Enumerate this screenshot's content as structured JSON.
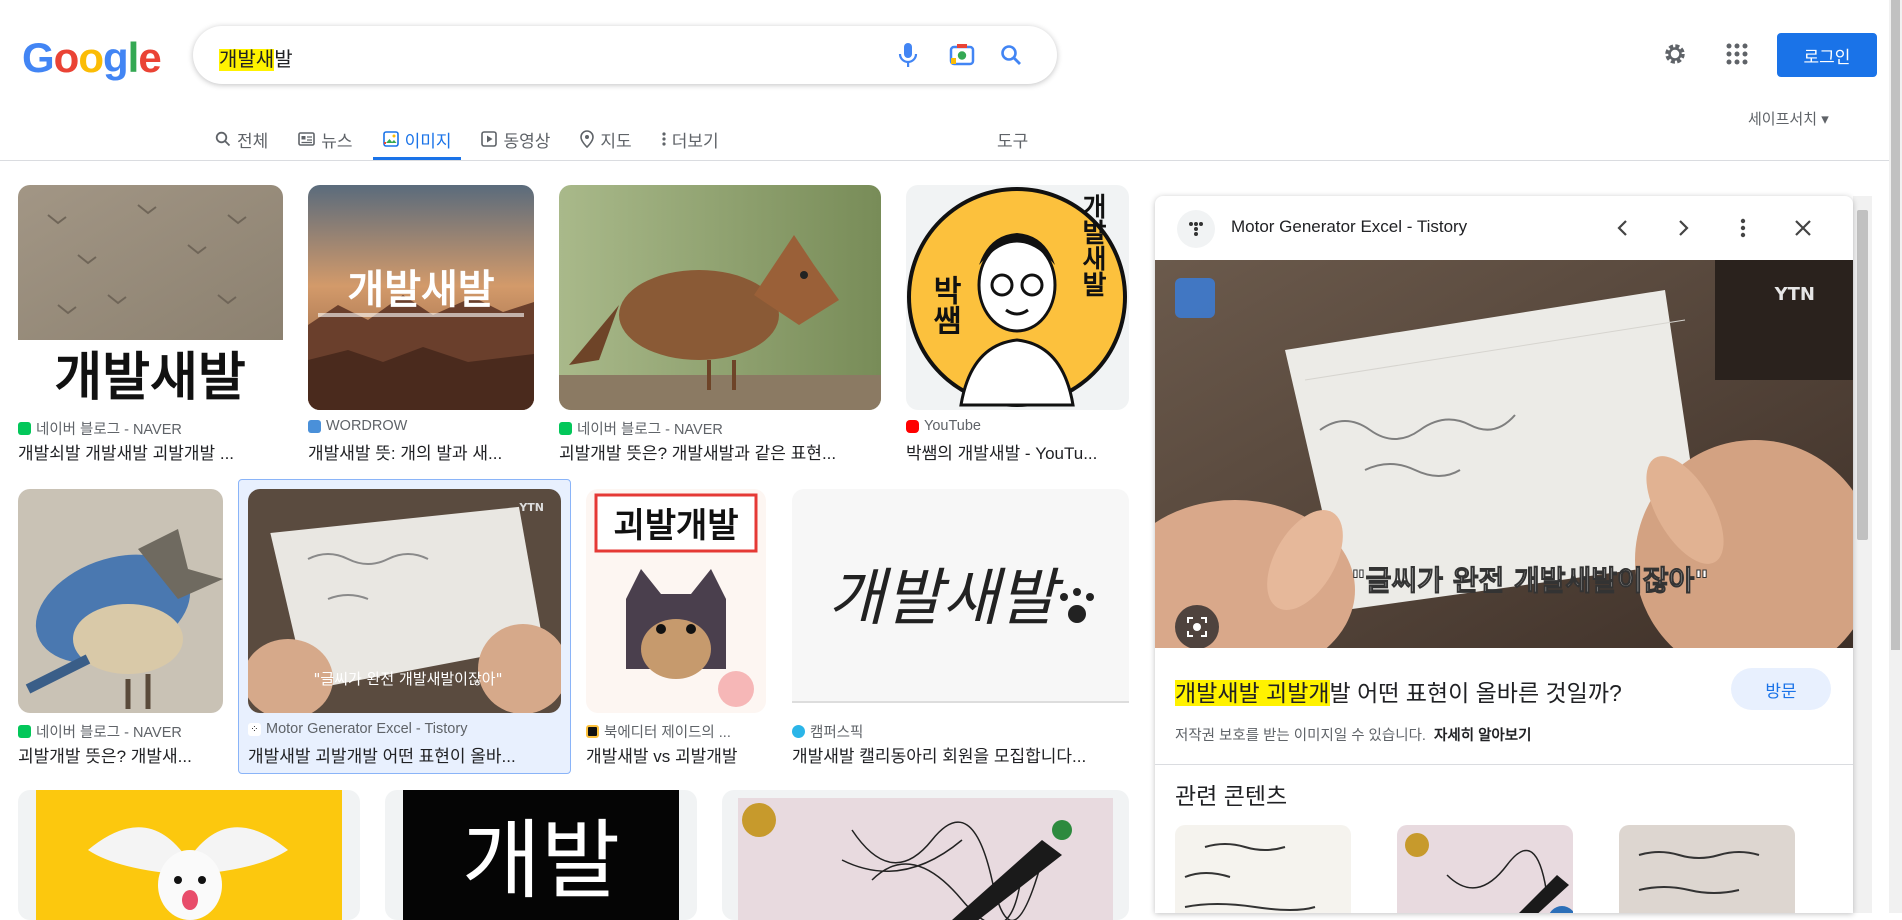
{
  "logo": [
    "G",
    "o",
    "o",
    "g",
    "l",
    "e"
  ],
  "search": {
    "query_highlight": "개발새",
    "query_rest": "발"
  },
  "header": {
    "login_label": "로그인"
  },
  "tabs": [
    {
      "label": "전체",
      "icon": "search-icon"
    },
    {
      "label": "뉴스",
      "icon": "news-icon"
    },
    {
      "label": "이미지",
      "icon": "image-icon",
      "active": true
    },
    {
      "label": "동영상",
      "icon": "video-icon"
    },
    {
      "label": "지도",
      "icon": "map-pin-icon"
    },
    {
      "label": "더보기",
      "icon": "more-vert-icon"
    }
  ],
  "tools_label": "도구",
  "safesearch_label": "세이프서치",
  "results": [
    {
      "source": "네이버 블로그 - NAVER",
      "title": "개발쇠발 개발새발 괴발개발 ..."
    },
    {
      "source": "WORDROW",
      "title": "개발새발 뜻: 개의 발과 새..."
    },
    {
      "source": "네이버 블로그 - NAVER",
      "title": "괴발개발 뜻은? 개발새발과 같은 표현..."
    },
    {
      "source": "YouTube",
      "title": "박쌤의 개발새발 - YouTu..."
    },
    {
      "source": "네이버 블로그 - NAVER",
      "title": "괴발개발 뜻은? 개발새..."
    },
    {
      "source": "Motor Generator Excel - Tistory",
      "title": "개발새발 괴발개발 어떤 표현이 올바..."
    },
    {
      "source": "북에디터 제이드의 ...",
      "title": "개발새발 vs 괴발개발"
    },
    {
      "source": "캠퍼스픽",
      "title": "개발새발 캘리동아리 회원을 모집합니다..."
    }
  ],
  "thumb_text": {
    "r1c1": "개발새발",
    "r1c2_big": "개발새발",
    "r1c4_left": "박쌤",
    "r1c4_right": "개발새발",
    "r2c3": "괴발개발",
    "r2c4": "개발새발",
    "r3c2": "개발"
  },
  "panel": {
    "site": "Motor Generator Excel - Tistory",
    "image_watermark": "YTN",
    "image_caption": "\"글씨가 완전 개발새발이잖아\"",
    "title_highlight": "개발새발 괴발개",
    "title_rest": "발 어떤 표현이 올바른 것일까?",
    "visit_label": "방문",
    "copyright_text": "저작권 보호를 받는 이미지일 수 있습니다.",
    "learn_more": "자세히 알아보기",
    "related_heading": "관련 콘텐츠"
  },
  "colors": {
    "accent": "#1a73e8",
    "highlight": "#fff200",
    "logo": [
      "#4285f4",
      "#ea4335",
      "#fbbc05",
      "#4285f4",
      "#34a853",
      "#ea4335"
    ]
  }
}
